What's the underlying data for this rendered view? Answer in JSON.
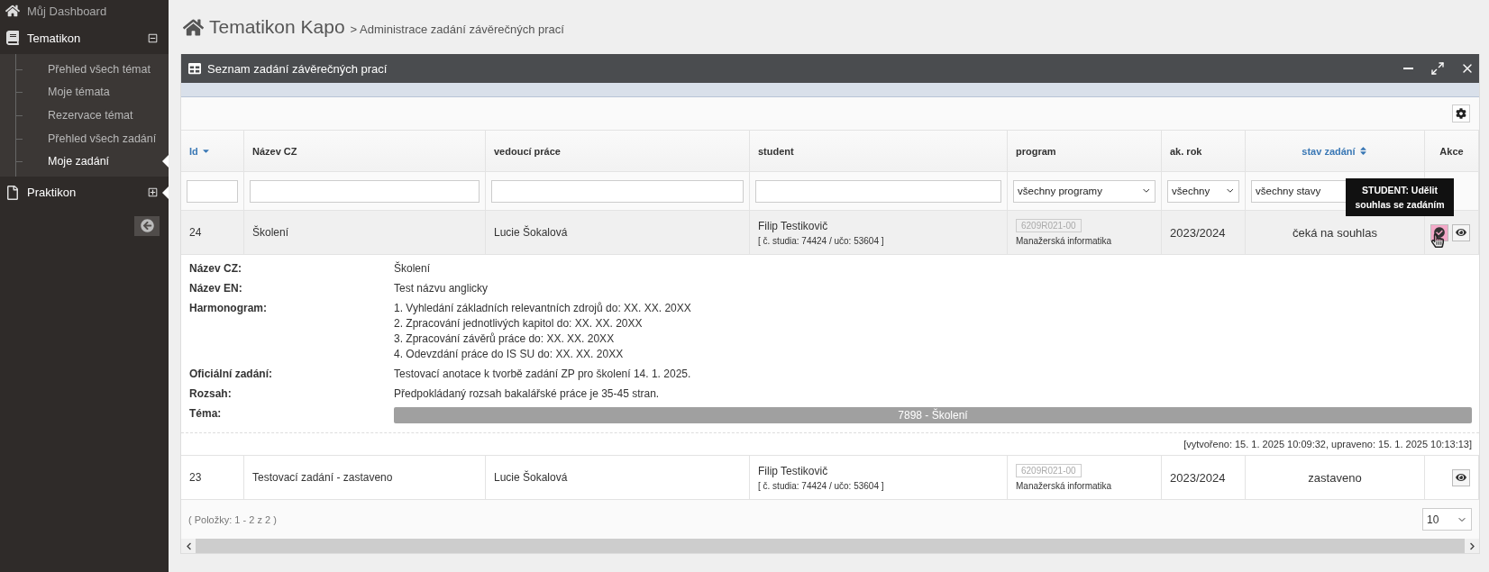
{
  "sidebar": {
    "items": [
      {
        "label": "Můj Dashboard",
        "highlighted": false
      },
      {
        "label": "Tematikon",
        "expanded": true,
        "highlighted": false,
        "children": [
          {
            "label": "Přehled všech témat",
            "selected": false
          },
          {
            "label": "Moje témata",
            "selected": false
          },
          {
            "label": "Rezervace témat",
            "selected": false
          },
          {
            "label": "Přehled všech zadání",
            "selected": false
          },
          {
            "label": "Moje zadání",
            "selected": true
          }
        ]
      },
      {
        "label": "Praktikon",
        "expanded": false,
        "highlighted": true
      }
    ]
  },
  "breadcrumb": {
    "title": "Tematikon Kapo",
    "path": "> Administrace zadání závěrečných prací"
  },
  "panel": {
    "title": "Seznam zadání závěrečných prací",
    "columns": [
      {
        "label": "Id",
        "sortable": true,
        "sorted_descending": true
      },
      {
        "label": "Název CZ",
        "sortable": false
      },
      {
        "label": "vedoucí práce",
        "sortable": false
      },
      {
        "label": "student",
        "sortable": false
      },
      {
        "label": "program",
        "sortable": false
      },
      {
        "label": "ak. rok",
        "sortable": false
      },
      {
        "label": "stav zadání",
        "sortable": true,
        "sorted_descending": false
      },
      {
        "label": "Akce",
        "sortable": false
      }
    ],
    "filters": [
      {
        "kind": "text"
      },
      {
        "kind": "text"
      },
      {
        "kind": "text"
      },
      {
        "kind": "text"
      },
      {
        "kind": "select",
        "value": "všechny programy",
        "arrow_visible": true
      },
      {
        "kind": "select",
        "value": "všechny",
        "arrow_visible": true
      },
      {
        "kind": "select",
        "value": "všechny stavy",
        "arrow_visible": false
      },
      {
        "kind": "none"
      }
    ],
    "rows": [
      {
        "id": "24",
        "name": "Školení",
        "supervisor": "Lucie Šokalová",
        "student": "Filip Testikovič",
        "student_ids": "[ č. studia: 74424 / učo: 53604 ]",
        "program_code": "6209R021-00",
        "program_name": "Manažerská informatika",
        "year": "2023/2024",
        "status": "čeká na souhlas",
        "expanded": true,
        "actions": [
          {
            "kind": "approve",
            "hovered": true
          },
          {
            "kind": "view",
            "hovered": false
          }
        ],
        "tooltip": "STUDENT: Udělit souhlas se zadáním",
        "detail": {
          "fields": [
            {
              "label": "Název CZ:",
              "lines": [
                "Školení"
              ]
            },
            {
              "label": "Název EN:",
              "lines": [
                "Test názvu anglicky"
              ]
            },
            {
              "label": "Harmonogram:",
              "lines": [
                "1. Vyhledání základních relevantních zdrojů do: XX. XX. 20XX",
                "2. Zpracování jednotlivých kapitol do: XX. XX. 20XX",
                "3. Zpracování závěrů práce do: XX. XX. 20XX",
                "4. Odevzdání práce do IS SU do: XX. XX. 20XX"
              ]
            },
            {
              "label": "Oficiální zadání:",
              "lines": [
                "Testovací anotace k tvorbě zadání ZP pro školení 14. 1. 2025."
              ]
            },
            {
              "label": "Rozsah:",
              "lines": [
                "Předpokládaný rozsah bakalářské práce je 35-45 stran."
              ]
            }
          ],
          "topic_label": "Téma:",
          "topic": "7898 - Školení",
          "timestamps": "[vytvořeno: 15. 1. 2025 10:09:32, upraveno: 15. 1. 2025 10:13:13]"
        }
      },
      {
        "id": "23",
        "name": "Testovací zadání - zastaveno",
        "supervisor": "Lucie Šokalová",
        "student": "Filip Testikovič",
        "student_ids": "[ č. studia: 74424 / učo: 53604 ]",
        "program_code": "6209R021-00",
        "program_name": "Manažerská informatika",
        "year": "2023/2024",
        "status": "zastaveno",
        "expanded": false,
        "actions": [
          {
            "kind": "view",
            "hovered": false
          }
        ]
      }
    ],
    "pager": "( Položky: 1 - 2 z 2 )",
    "page_size": "10"
  }
}
